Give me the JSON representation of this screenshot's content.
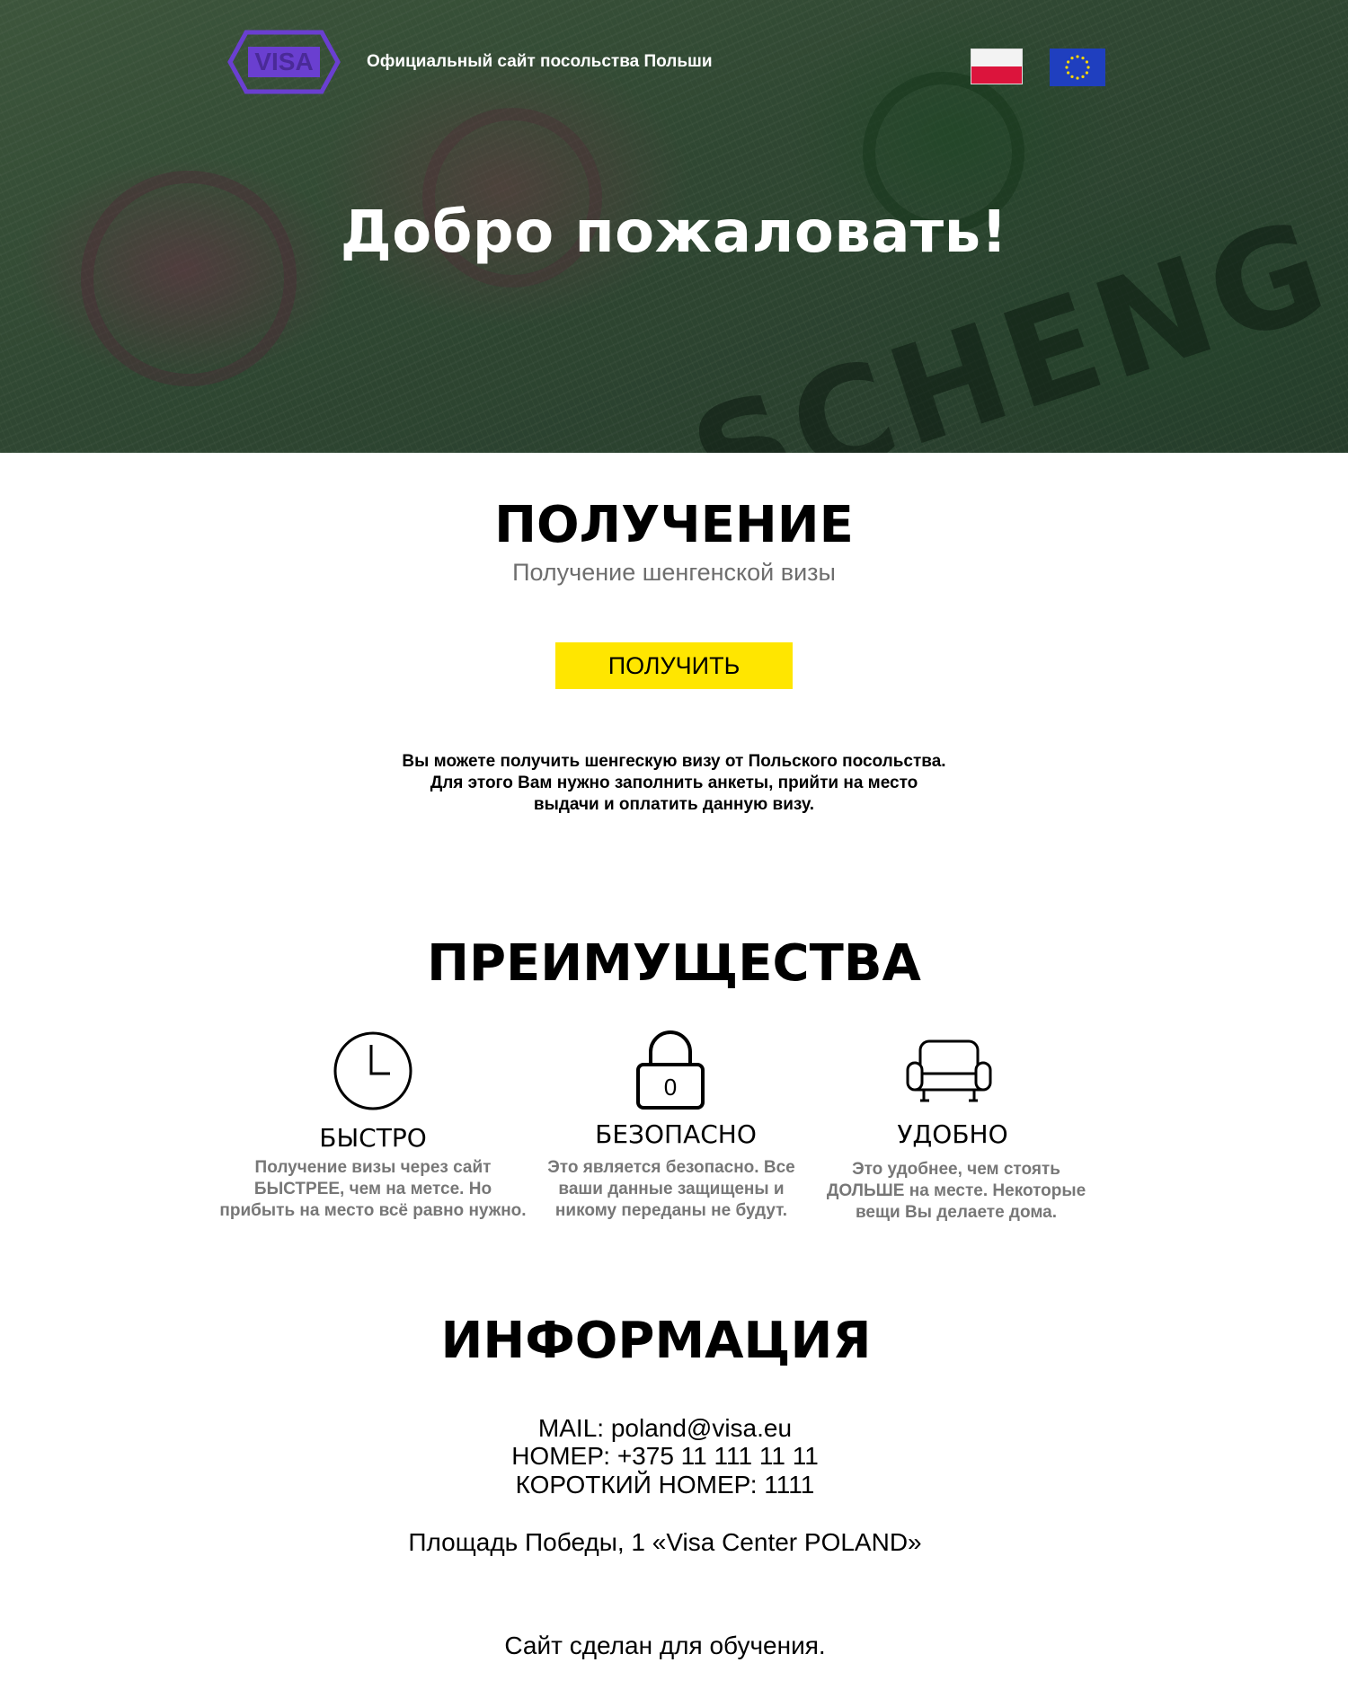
{
  "header": {
    "logo_text": "VISA",
    "title": "Официальный сайт посольства Польши",
    "flags": [
      "flag-poland-icon",
      "flag-eu-icon"
    ]
  },
  "hero": {
    "title": "Добро пожаловать!"
  },
  "obtain": {
    "title": "ПОЛУЧЕНИЕ",
    "subtitle": "Получение шенгенской визы",
    "button_label": "ПОЛУЧИТЬ",
    "description": [
      "Вы можете получить шенгескую визу от Польского посольства.",
      "Для этого Вам нужно заполнить анкеты, прийти на место",
      "выдачи и оплатить данную визу."
    ]
  },
  "advantages": {
    "title": "ПРЕИМУЩЕСТВА",
    "items": [
      {
        "icon": "clock-icon",
        "title": "БЫСТРО",
        "lines": [
          "Получение визы через сайт",
          "БЫСТРЕЕ, чем на метсе. Но",
          "прибыть на место всё равно нужно."
        ]
      },
      {
        "icon": "padlock-icon",
        "icon_text": "0",
        "title": "БЕЗОПАСНО",
        "lines": [
          "Это является безопасно. Все",
          "ваши данные защищены и",
          "никому переданы не будут."
        ]
      },
      {
        "icon": "armchair-icon",
        "title": "УДОБНО",
        "lines": [
          "Это удобнее, чем стоять",
          "ДОЛЬШЕ на месте. Некоторые",
          "вещи Вы делаете дома."
        ]
      }
    ]
  },
  "info": {
    "title": "ИНФОРМАЦИЯ",
    "mail": "MAIL: poland@visa.eu",
    "phone": "НОМЕР: +375 11 111 11 11",
    "short_phone": "КОРОТКИЙ НОМЕР: 1111",
    "address": "Площадь Победы, 1 «Visa Center POLAND»"
  },
  "footer": {
    "note": "Сайт сделан для обучения."
  },
  "colors": {
    "accent_button": "#ffe600",
    "logo_purple": "#6a3fd0",
    "muted_text": "#777777"
  }
}
